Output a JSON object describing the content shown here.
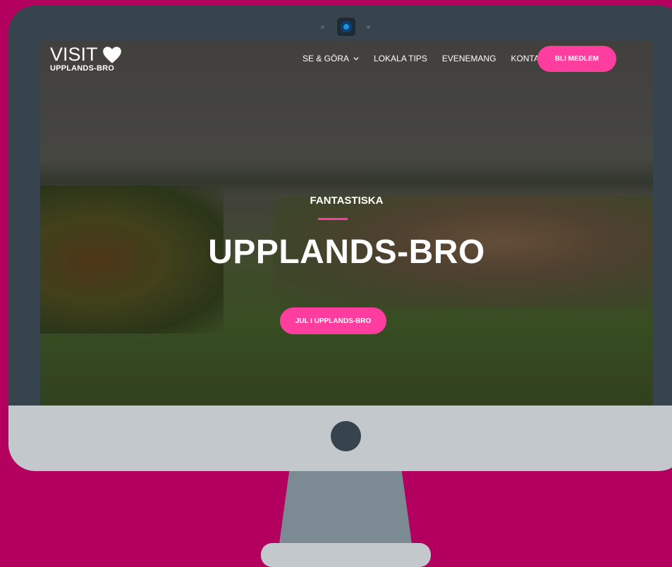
{
  "logo": {
    "visit": "VISIT",
    "place": "UPPLANDS-BRO",
    "icon": "heart-icon"
  },
  "nav": {
    "items": [
      {
        "label": "SE & GÖRA",
        "has_dropdown": true
      },
      {
        "label": "LOKALA TIPS"
      },
      {
        "label": "EVENEMANG"
      },
      {
        "label": "KONTAKT"
      }
    ],
    "cta_label": "BLI MEDLEM"
  },
  "hero": {
    "kicker": "FANTASTISKA",
    "title": "UPPLANDS-BRO",
    "button_label": "JUL I UPPLANDS-BRO"
  },
  "colors": {
    "accent": "#ff3d9e",
    "page_background": "#b3005e",
    "bezel": "#37434d",
    "chin": "#c3c8cc",
    "stand": "#7c8a93"
  }
}
